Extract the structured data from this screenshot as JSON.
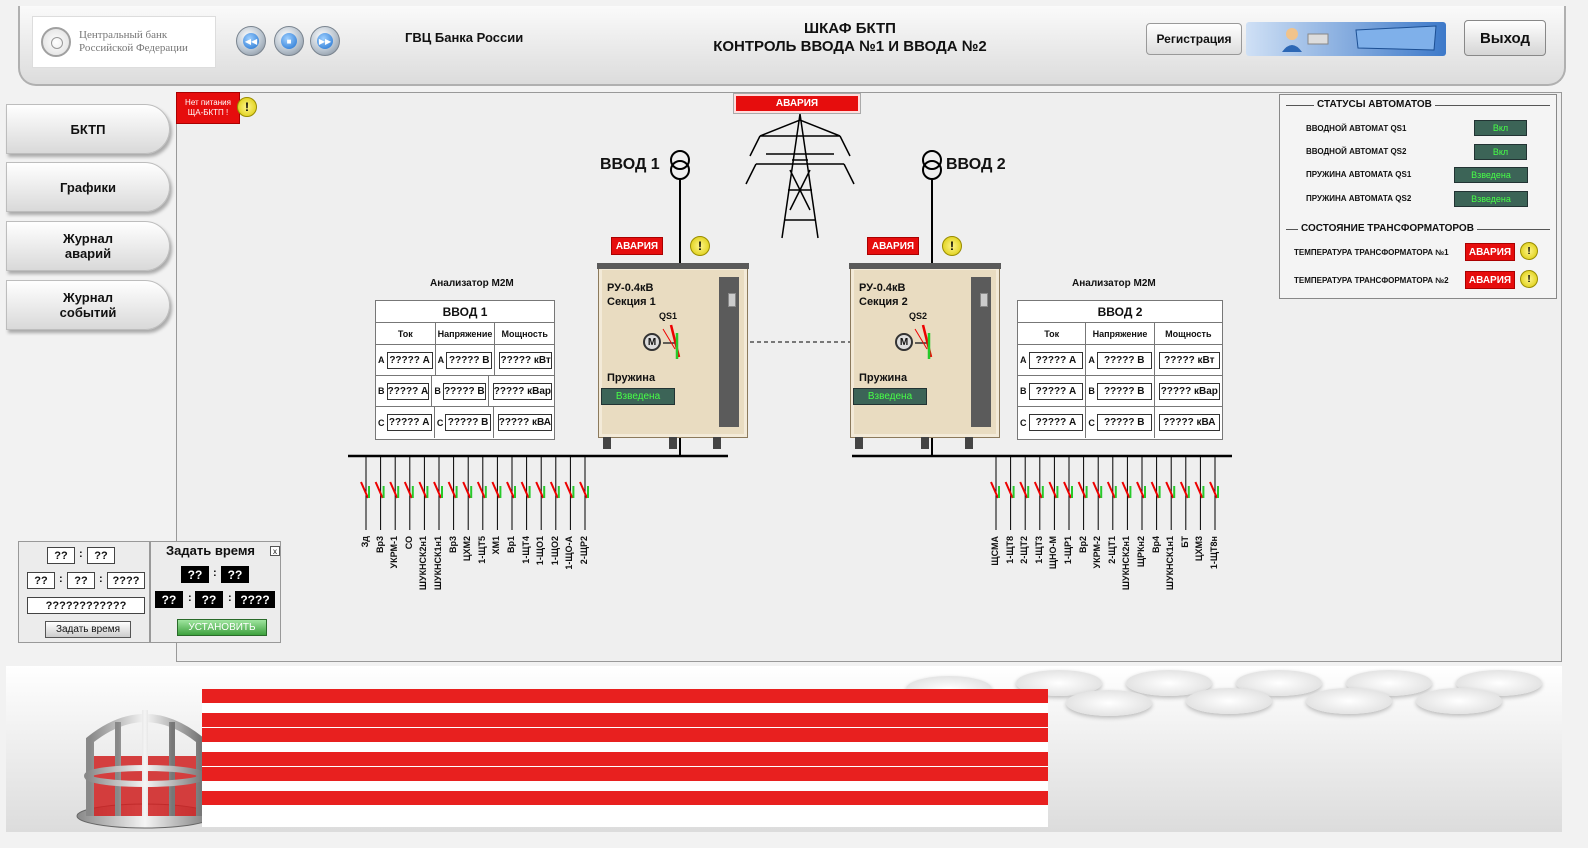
{
  "header": {
    "logo_line1": "Центральный банк",
    "logo_line2": "Российской Федерации",
    "org": "ГВЦ Банка России",
    "title_line1": "ШКАФ БКТП",
    "title_line2": "КОНТРОЛЬ ВВОДА №1 И ВВОДА №2",
    "register_label": "Регистрация",
    "exit_label": "Выход",
    "nav_icons": [
      "arrow-back-icon",
      "stop-icon",
      "arrow-forward-icon"
    ]
  },
  "sidebar": {
    "items": [
      {
        "label": "БКТП"
      },
      {
        "label": "Графики"
      },
      {
        "label": "Журнал\nаварий"
      },
      {
        "label": "Журнал\nсобытий"
      }
    ]
  },
  "alerts": {
    "no_power_line1": "Нет питания",
    "no_power_line2": "ЩА-БКТП !",
    "top_alarm": "АВАРИЯ"
  },
  "inputs": {
    "input1_label": "ВВОД 1",
    "input2_label": "ВВОД 2",
    "alarm1": "АВАРИЯ",
    "alarm2": "АВАРИЯ"
  },
  "analyzers": [
    {
      "caption": "Анализатор M2M",
      "title": "ВВОД 1",
      "headers": [
        "Ток",
        "Напряжение",
        "Мощность"
      ],
      "rows": [
        {
          "phase": "A",
          "current": "????? А",
          "voltage": "????? В",
          "power": "????? кВт"
        },
        {
          "phase": "B",
          "current": "????? А",
          "voltage": "????? В",
          "power": "????? кВар"
        },
        {
          "phase": "C",
          "current": "????? А",
          "voltage": "????? В",
          "power": "????? кВА"
        }
      ]
    },
    {
      "caption": "Анализатор M2M",
      "title": "ВВОД 2",
      "headers": [
        "Ток",
        "Напряжение",
        "Мощность"
      ],
      "rows": [
        {
          "phase": "A",
          "current": "????? А",
          "voltage": "????? В",
          "power": "????? кВт"
        },
        {
          "phase": "B",
          "current": "????? А",
          "voltage": "????? В",
          "power": "????? кВар"
        },
        {
          "phase": "C",
          "current": "????? А",
          "voltage": "????? В",
          "power": "????? кВА"
        }
      ]
    }
  ],
  "cabinets": [
    {
      "line1": "РУ-0.4кВ",
      "line2": "Секция 1",
      "switch": "QS1",
      "motor": "M",
      "spring_label": "Пружина",
      "spring_state": "Взведена"
    },
    {
      "line1": "РУ-0.4кВ",
      "line2": "Секция 2",
      "switch": "QS2",
      "motor": "M",
      "spring_label": "Пружина",
      "spring_state": "Взведена"
    }
  ],
  "feeders_left": [
    "Зд",
    "Вр3",
    "УКРМ-1",
    "СО",
    "ШУКНСК2н1",
    "ШУКНСК1н1",
    "Вр3",
    "ЦХМ2",
    "1-ЩТ5",
    "ХМ1",
    "Вр1",
    "1-ЩТ4",
    "1-ЩО1",
    "1-ЩО2",
    "1-ЩО-А",
    "2-ЩР2"
  ],
  "feeders_right": [
    "ЩСМА",
    "1-ЩТ8",
    "2-ЩТ2",
    "1-ЩТ3",
    "ЩНО-М",
    "1-ЩР1",
    "Вр2",
    "УКРМ-2",
    "2-ЩТ1",
    "ШУКНСК2н1",
    "ЩРКн2",
    "Вр4",
    "ШУКНСК1н1",
    "БТ",
    "ЦХМ3",
    "1-ЩТ8н"
  ],
  "status_panel": {
    "section1": "СТАТУСЫ АВТОМАТОВ",
    "rows": [
      {
        "label": "ВВОДНОЙ АВТОМАТ QS1",
        "value": "Вкл"
      },
      {
        "label": "ВВОДНОЙ АВТОМАТ QS2",
        "value": "Вкл"
      },
      {
        "label": "ПРУЖИНА АВТОМАТА  QS1",
        "value": "Взведена"
      },
      {
        "label": "ПРУЖИНА АВТОМАТА  QS2",
        "value": "Взведена"
      }
    ],
    "section2": "СОСТОЯНИЕ ТРАНСФОРМАТОРОВ",
    "trans_rows": [
      {
        "label": "ТЕМПЕРАТУРА ТРАНСФОРМАТОРА №1",
        "value": "АВАРИЯ"
      },
      {
        "label": "ТЕМПЕРАТУРА ТРАНСФОРМАТОРА №2",
        "value": "АВАРИЯ"
      }
    ]
  },
  "clock": {
    "hh": "??",
    "mm": "??",
    "d": "??",
    "m": "??",
    "y": "????",
    "full": "????????????",
    "button": "Задать время"
  },
  "set_time": {
    "title": "Задать время",
    "close": "x",
    "hh": "??",
    "mm": "??",
    "d": "??",
    "m": "??",
    "y": "????",
    "button": "УСТАНОВИТЬ"
  },
  "colors": {
    "alarm": "#e60d0d",
    "status_bg": "#3c6457",
    "status_text": "#47ff47"
  }
}
